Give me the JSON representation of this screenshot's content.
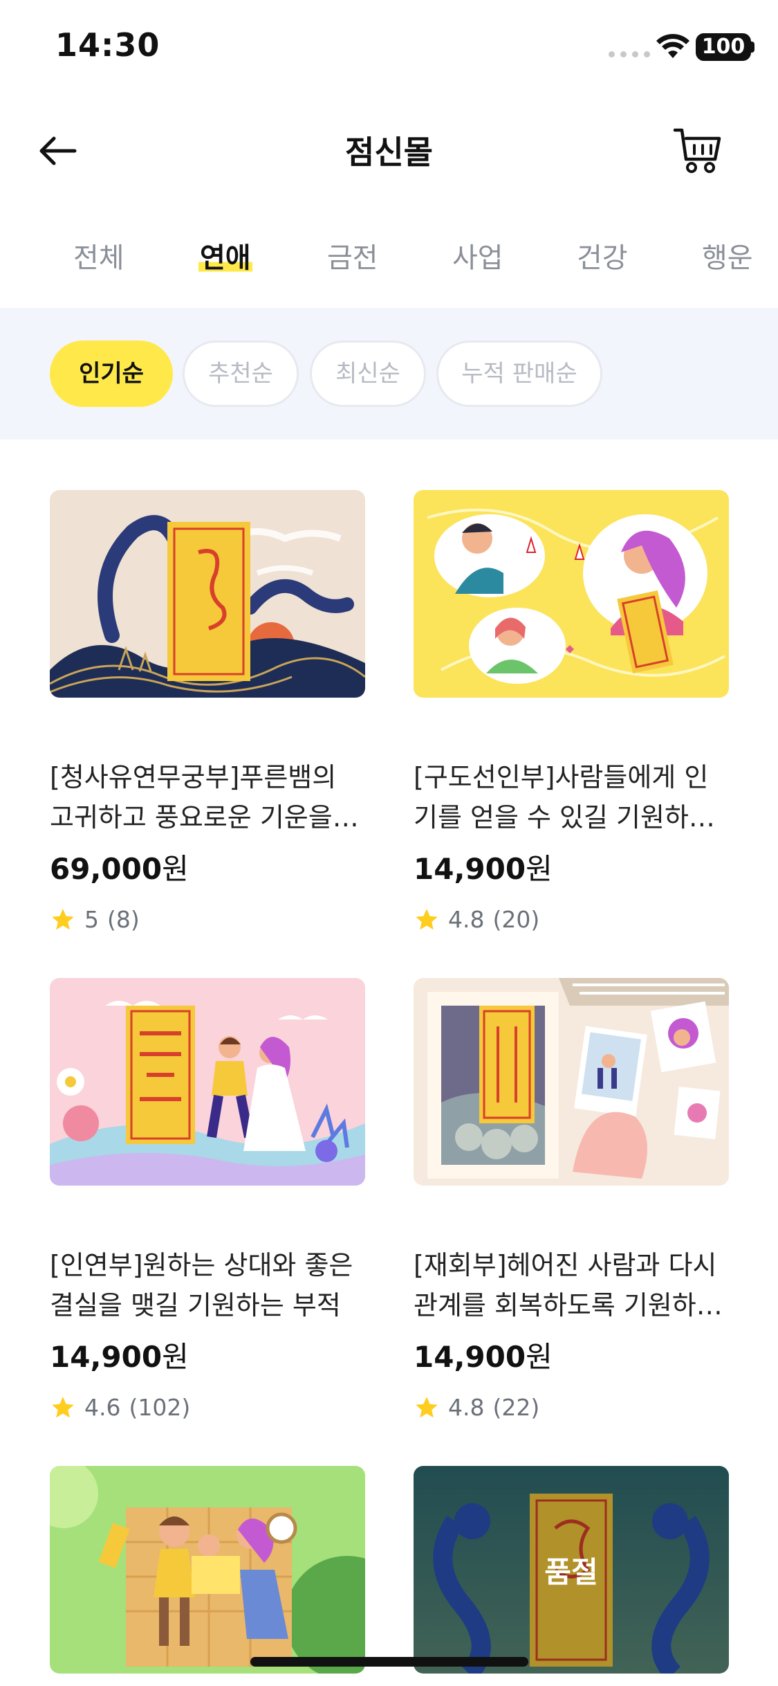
{
  "status_bar": {
    "time": "14:30",
    "battery": "100"
  },
  "header": {
    "title": "점신몰"
  },
  "tabs": [
    {
      "label": "전체",
      "active": false
    },
    {
      "label": "연애",
      "active": true
    },
    {
      "label": "금전",
      "active": false
    },
    {
      "label": "사업",
      "active": false
    },
    {
      "label": "건강",
      "active": false
    },
    {
      "label": "행운",
      "active": false
    }
  ],
  "sort_options": [
    {
      "label": "인기순",
      "active": true
    },
    {
      "label": "추천순",
      "active": false
    },
    {
      "label": "최신순",
      "active": false
    },
    {
      "label": "누적 판매순",
      "active": false
    }
  ],
  "products": [
    {
      "title": "[청사유연무궁부]푸른뱀의 고귀하고 풍요로운 기운을 받아 인연이 무궁하길 기원하는 부적",
      "price": "69,000",
      "currency": "원",
      "rating": "5",
      "reviews": "(8)"
    },
    {
      "title": "[구도선인부]사람들에게 인기를 얻을 수 있길 기원하는 부적",
      "price": "14,900",
      "currency": "원",
      "rating": "4.8",
      "reviews": "(20)"
    },
    {
      "title": "[인연부]원하는 상대와 좋은 결실을 맺길 기원하는 부적",
      "price": "14,900",
      "currency": "원",
      "rating": "4.6",
      "reviews": "(102)"
    },
    {
      "title": "[재회부]헤어진 사람과 다시 관계를 회복하도록 기원하는 부적",
      "price": "14,900",
      "currency": "원",
      "rating": "4.8",
      "reviews": "(22)"
    },
    {
      "title": "",
      "price": "",
      "currency": "",
      "rating": "",
      "reviews": ""
    },
    {
      "title": "",
      "price": "",
      "currency": "",
      "rating": "",
      "reviews": "",
      "badge": "품절"
    }
  ],
  "colors": {
    "accent": "#ffe94a",
    "sort_bg": "#f2f5fb",
    "star": "#ffcd1f"
  }
}
